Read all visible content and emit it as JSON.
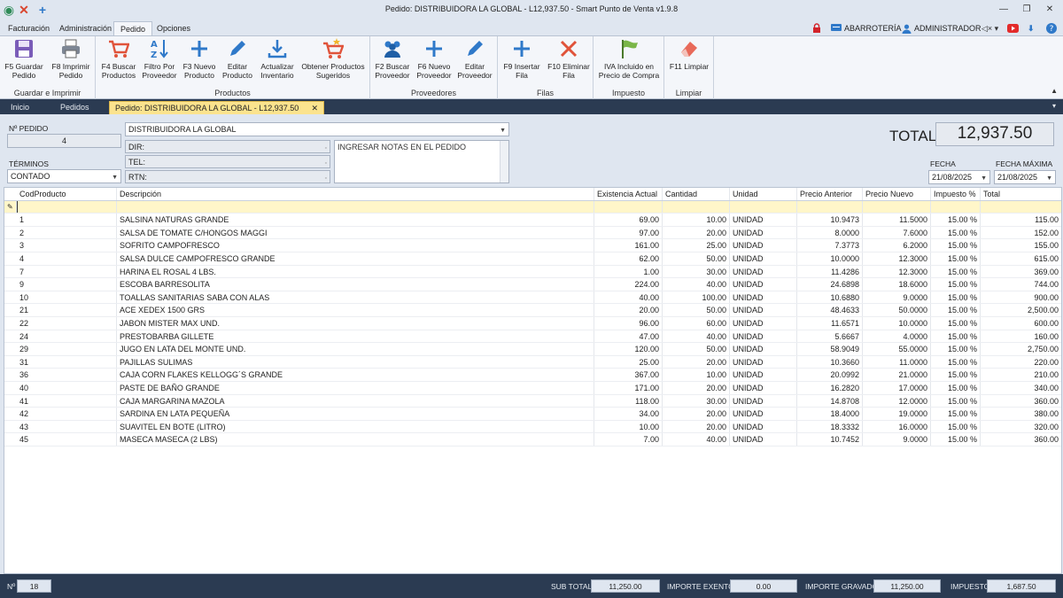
{
  "window": {
    "title": "Pedido: DISTRIBUIDORA LA GLOBAL - L12,937.50 - Smart Punto de Venta v1.9.8"
  },
  "menu_tabs": [
    "Facturación",
    "Administración",
    "Pedido",
    "Opciones"
  ],
  "userbar": {
    "store": "ABARROTERÍA",
    "user": "ADMINISTRADOR"
  },
  "ribbon": {
    "groups": {
      "guardar": "Guardar e Imprimir",
      "productos": "Productos",
      "proveedores": "Proveedores",
      "filas": "Filas",
      "impuesto": "Impuesto",
      "limpiar": "Limpiar"
    },
    "buttons": {
      "guardar": [
        "F5 Guardar",
        "Pedido"
      ],
      "imprimir": [
        "F8 Imprimir",
        "Pedido"
      ],
      "buscar_productos": [
        "F4 Buscar",
        "Productos"
      ],
      "filtro_proveedor": [
        "Filtro Por",
        "Proveedor"
      ],
      "nuevo_producto": [
        "F3 Nuevo",
        "Producto"
      ],
      "editar_producto": [
        "Editar",
        "Producto"
      ],
      "actualizar_inventario": [
        "Actualizar",
        "Inventario"
      ],
      "sugeridos": [
        "Obtener Productos",
        "Sugeridos"
      ],
      "buscar_proveedor": [
        "F2 Buscar",
        "Proveedor"
      ],
      "nuevo_proveedor": [
        "F6 Nuevo",
        "Proveedor"
      ],
      "editar_proveedor": [
        "Editar",
        "Proveedor"
      ],
      "insertar_fila": [
        "F9 Insertar",
        "Fila"
      ],
      "eliminar_fila": [
        "F10 Eliminar",
        "Fila"
      ],
      "iva": [
        "IVA Incluido en",
        "Precio de Compra"
      ],
      "limpiar": [
        "F11 Limpiar",
        ""
      ]
    }
  },
  "doc_tabs": {
    "inicio": "Inicio",
    "pedidos": "Pedidos",
    "active": "Pedido: DISTRIBUIDORA LA GLOBAL - L12,937.50"
  },
  "form": {
    "pedido_label": "Nº PEDIDO",
    "pedido_value": "4",
    "proveedor": "DISTRIBUIDORA LA GLOBAL",
    "dir_label": "DIR:",
    "tel_label": "TEL:",
    "rtn_label": "RTN:",
    "notes_placeholder": "INGRESAR NOTAS EN EL PEDIDO",
    "terminos_label": "TÉRMINOS",
    "terminos_value": "CONTADO",
    "total_label": "TOTAL",
    "total_value": "12,937.50",
    "fecha_label": "FECHA",
    "fecha_value": "21/08/2025",
    "fecha_max_label": "FECHA MÁXIMA",
    "fecha_max_value": "21/08/2025"
  },
  "grid": {
    "columns": [
      "CodProducto",
      "Descripción",
      "Existencia Actual",
      "Cantidad",
      "Unidad",
      "Precio Anterior",
      "Precio Nuevo",
      "Impuesto %",
      "Total"
    ],
    "rows": [
      [
        "1",
        "SALSINA NATURAS GRANDE",
        "69.00",
        "10.00",
        "UNIDAD",
        "10.9473",
        "11.5000",
        "15.00 %",
        "115.00"
      ],
      [
        "2",
        "SALSA DE TOMATE C/HONGOS MAGGI",
        "97.00",
        "20.00",
        "UNIDAD",
        "8.0000",
        "7.6000",
        "15.00 %",
        "152.00"
      ],
      [
        "3",
        "SOFRITO CAMPOFRESCO",
        "161.00",
        "25.00",
        "UNIDAD",
        "7.3773",
        "6.2000",
        "15.00 %",
        "155.00"
      ],
      [
        "4",
        "SALSA DULCE CAMPOFRESCO GRANDE",
        "62.00",
        "50.00",
        "UNIDAD",
        "10.0000",
        "12.3000",
        "15.00 %",
        "615.00"
      ],
      [
        "7",
        "HARINA EL ROSAL 4 LBS.",
        "1.00",
        "30.00",
        "UNIDAD",
        "11.4286",
        "12.3000",
        "15.00 %",
        "369.00"
      ],
      [
        "9",
        "ESCOBA BARRESOLITA",
        "224.00",
        "40.00",
        "UNIDAD",
        "24.6898",
        "18.6000",
        "15.00 %",
        "744.00"
      ],
      [
        "10",
        "TOALLAS SANITARIAS SABA CON ALAS",
        "40.00",
        "100.00",
        "UNIDAD",
        "10.6880",
        "9.0000",
        "15.00 %",
        "900.00"
      ],
      [
        "21",
        "ACE XEDEX 1500 GRS",
        "20.00",
        "50.00",
        "UNIDAD",
        "48.4633",
        "50.0000",
        "15.00 %",
        "2,500.00"
      ],
      [
        "22",
        "JABON MISTER MAX UND.",
        "96.00",
        "60.00",
        "UNIDAD",
        "11.6571",
        "10.0000",
        "15.00 %",
        "600.00"
      ],
      [
        "24",
        "PRESTOBARBA GILLETE",
        "47.00",
        "40.00",
        "UNIDAD",
        "5.6667",
        "4.0000",
        "15.00 %",
        "160.00"
      ],
      [
        "29",
        "JUGO EN LATA DEL MONTE UND.",
        "120.00",
        "50.00",
        "UNIDAD",
        "58.9049",
        "55.0000",
        "15.00 %",
        "2,750.00"
      ],
      [
        "31",
        "PAJILLAS SULIMAS",
        "25.00",
        "20.00",
        "UNIDAD",
        "10.3660",
        "11.0000",
        "15.00 %",
        "220.00"
      ],
      [
        "36",
        "CAJA CORN FLAKES KELLOGG´S GRANDE",
        "367.00",
        "10.00",
        "UNIDAD",
        "20.0992",
        "21.0000",
        "15.00 %",
        "210.00"
      ],
      [
        "40",
        "PASTE DE BAÑO GRANDE",
        "171.00",
        "20.00",
        "UNIDAD",
        "16.2820",
        "17.0000",
        "15.00 %",
        "340.00"
      ],
      [
        "41",
        "CAJA MARGARINA MAZOLA",
        "118.00",
        "30.00",
        "UNIDAD",
        "14.8708",
        "12.0000",
        "15.00 %",
        "360.00"
      ],
      [
        "42",
        "SARDINA EN LATA PEQUEÑA",
        "34.00",
        "20.00",
        "UNIDAD",
        "18.4000",
        "19.0000",
        "15.00 %",
        "380.00"
      ],
      [
        "43",
        "SUAVITEL EN BOTE (LITRO)",
        "10.00",
        "20.00",
        "UNIDAD",
        "18.3332",
        "16.0000",
        "15.00 %",
        "320.00"
      ],
      [
        "45",
        "MASECA MASECA (2 LBS)",
        "7.00",
        "40.00",
        "UNIDAD",
        "10.7452",
        "9.0000",
        "15.00 %",
        "360.00"
      ]
    ]
  },
  "footer": {
    "count_label": "Nº",
    "count_value": "18",
    "subtotal_label": "SUB TOTAL",
    "subtotal_value": "11,250.00",
    "exento_label": "IMPORTE EXENTO",
    "exento_value": "0.00",
    "gravado_label": "IMPORTE GRAVADO",
    "gravado_value": "11,250.00",
    "impuesto_label": "IMPUESTO",
    "impuesto_value": "1,687.50"
  },
  "colors": {
    "accent_tab": "#fbe38e",
    "dark_bar": "#2b3b52",
    "filter_row": "#fff6c9"
  }
}
